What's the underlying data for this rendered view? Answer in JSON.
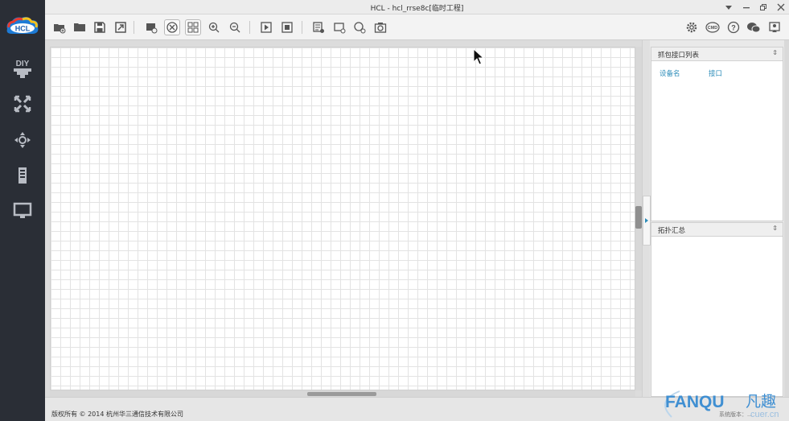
{
  "window": {
    "title": "HCL - hcl_rrse8c[临时工程]"
  },
  "logo": {
    "text": "HCL"
  },
  "sidebar": {
    "items": [
      {
        "icon": "diy-icon",
        "label": "DIY"
      },
      {
        "icon": "router-icon"
      },
      {
        "icon": "switch-icon"
      },
      {
        "icon": "server-icon"
      },
      {
        "icon": "pc-icon"
      }
    ]
  },
  "toolbar": {
    "buttons": [
      "new-project-icon",
      "open-project-icon",
      "save-project-icon",
      "export-icon",
      "screenshot-icon",
      "device-view-icon",
      "grid-toggle-icon",
      "zoom-in-icon",
      "zoom-out-icon",
      "start-all-icon",
      "stop-all-icon",
      "command-list-icon",
      "add-note-icon",
      "add-link-icon",
      "capture-icon",
      "settings-icon",
      "cmd-icon",
      "help-icon",
      "wechat-icon",
      "feedback-icon"
    ],
    "cmd_label": "CMD"
  },
  "panels": {
    "capture": {
      "title": "抓包接口列表",
      "columns": [
        "设备名",
        "接口"
      ]
    },
    "topology": {
      "title": "拓扑汇总"
    }
  },
  "statusbar": {
    "copyright": "版权所有 © 2014 杭州华三通信技术有限公司",
    "version": "系统版本：..."
  },
  "watermark": {
    "brand": "FANQU",
    "brand_cn": "凡趣",
    "domain": "cuer.cn"
  },
  "colors": {
    "sidebar_bg": "#2a2e36",
    "accent": "#2a8bb8",
    "logo_red": "#e83a2f",
    "logo_yellow": "#f6c21b",
    "logo_blue": "#1d7bd6"
  }
}
